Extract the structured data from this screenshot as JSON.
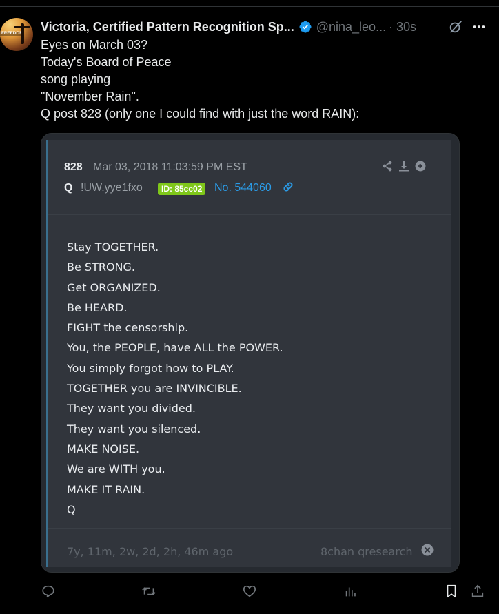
{
  "tweet": {
    "display_name": "Victoria, Certified Pattern Recognition Sp...",
    "handle": "@nina_leo...",
    "time": "· 30s",
    "lines": [
      "Eyes on March 03?",
      "Today's Board of Peace",
      "song playing",
      "\"November Rain\".",
      "Q post 828 (only one I could find with just the word RAIN):"
    ],
    "avatar_text": "FREEDOM"
  },
  "post": {
    "number": "828",
    "date": "Mar 03, 2018 11:03:59 PM EST",
    "author": "Q",
    "tripcode": "!UW.yye1fxo",
    "id_badge": "ID: 85cc02",
    "post_no": "No. 544060",
    "body": [
      "Stay TOGETHER.",
      "Be STRONG.",
      "Get ORGANIZED.",
      "Be HEARD.",
      "FIGHT the censorship.",
      "You, the PEOPLE, have ALL the POWER.",
      "You simply forgot how to PLAY.",
      "TOGETHER you are INVINCIBLE.",
      "They want you divided.",
      "They want you silenced.",
      "MAKE NOISE.",
      "We are WITH you.",
      "MAKE IT RAIN.",
      "Q"
    ],
    "age": "7y, 11m, 2w, 2d, 2h, 46m ago",
    "source": "8chan qresearch"
  },
  "colors": {
    "verified": "#1d9bf0",
    "id_badge": "#7fc71a",
    "post_link": "#2b9be6",
    "muted": "#71767b"
  },
  "icons": {
    "header": [
      "verified-badge-icon",
      "grok-icon",
      "more-icon"
    ],
    "post": [
      "share-icon",
      "download-icon",
      "forward-icon",
      "link-icon",
      "close-icon"
    ],
    "actions": [
      "reply-icon",
      "retweet-icon",
      "like-icon",
      "views-icon",
      "bookmark-icon",
      "share-icon"
    ]
  }
}
